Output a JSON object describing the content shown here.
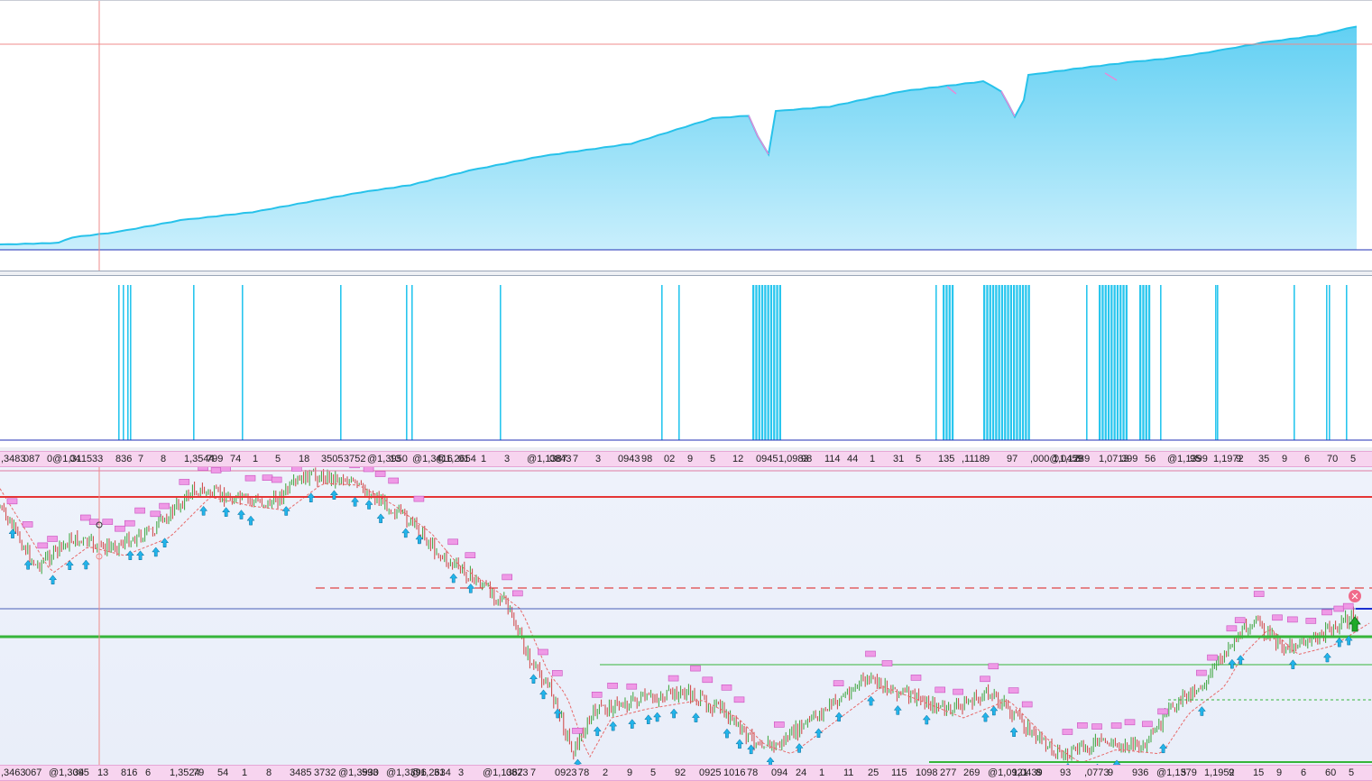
{
  "colors": {
    "equity_fill": "#7ed8f5",
    "equity_line": "#27c2ea",
    "drawdown": "#e58ad8",
    "signal_bar": "#29c6ee",
    "axis_line": "#1f2fb4",
    "resistance_line": "#e53535",
    "support_line": "#36b53a",
    "cursor_line": "#ef8b8b",
    "tag": "#ef9ae6",
    "arrow": "#22b4ea"
  },
  "top_labels": [
    ",3483",
    "087",
    "0@1,3115",
    "04",
    "33",
    "836",
    "7",
    "8",
    "1,3544",
    "799",
    "74",
    "1",
    "5",
    "18",
    "3505",
    "3752",
    "@1,3950",
    "13",
    "@1,3416",
    "@1,2654",
    "01",
    "1",
    "3",
    "@1,1387",
    "0843",
    "7",
    "3",
    "0943",
    "98",
    "02",
    "9",
    "5",
    "12",
    "0945",
    "1,0983",
    "98",
    "114",
    "44",
    "1",
    "31",
    "5",
    "135",
    ",1118",
    "9",
    "97",
    ",000@1,1289",
    "1,0459",
    "8",
    "1,0713",
    "399",
    "56",
    "@1,1399",
    "95",
    "1,1972",
    "9",
    "35",
    "9",
    "6",
    "70",
    "5"
  ],
  "bottom_labels": [
    ",3463",
    "067",
    "@1,3095",
    "34",
    "13",
    "816",
    "6",
    "1,3524",
    "79",
    "54",
    "1",
    "8",
    "3485",
    "3732",
    "@1,3930",
    "593",
    "@1,3396",
    "@1,2634",
    "31",
    "3",
    "@1,1367",
    "0823",
    "7",
    "0923",
    "78",
    "2",
    "9",
    "5",
    "92",
    "0925",
    "1016",
    "78",
    "094",
    "24",
    "1",
    "11",
    "25",
    "115",
    "1098",
    "277",
    "269",
    "@1,0921",
    "1,0439",
    "8",
    "93",
    ",0773",
    "9",
    "936",
    "@1,1379",
    "5",
    "1,1952",
    "9",
    "15",
    "9",
    "6",
    "60",
    "5"
  ]
}
